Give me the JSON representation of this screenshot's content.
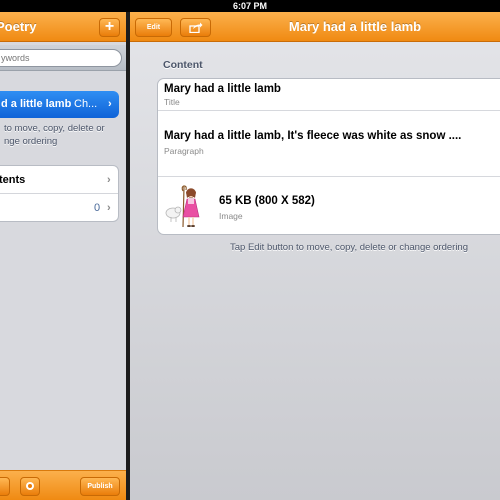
{
  "status_bar": {
    "time": "6:07 PM"
  },
  "master": {
    "title": "Poetry",
    "add_label": "+",
    "search_placeholder": "ywords",
    "selected_item": {
      "label": "d a little lamb",
      "sub": "Ch...",
      "chevron": "›"
    },
    "hint": "to move, copy, delete or\nnge ordering",
    "group_rows": [
      {
        "label": "tents",
        "count": "",
        "chevron": "›"
      },
      {
        "label": "",
        "count": "0",
        "chevron": "›"
      }
    ],
    "toolbar": {
      "left_label": "",
      "publish_label": "Publish"
    }
  },
  "detail": {
    "edit_label": "Edit",
    "title": "Mary had a little lamb",
    "section_header": "Content",
    "rows": [
      {
        "main": "Mary had a little lamb",
        "sub": "Title"
      },
      {
        "main": "Mary had a little lamb, It's fleece was white as snow ....",
        "sub": "Paragraph"
      },
      {
        "main": "65 KB (800 X 582)",
        "sub": "Image",
        "icon": "girl-with-lamb-thumbnail"
      }
    ],
    "hint": "Tap Edit button to move, copy, delete or change ordering"
  },
  "colors": {
    "accent_orange": "#f08a12",
    "selection_blue": "#1a73e8"
  }
}
